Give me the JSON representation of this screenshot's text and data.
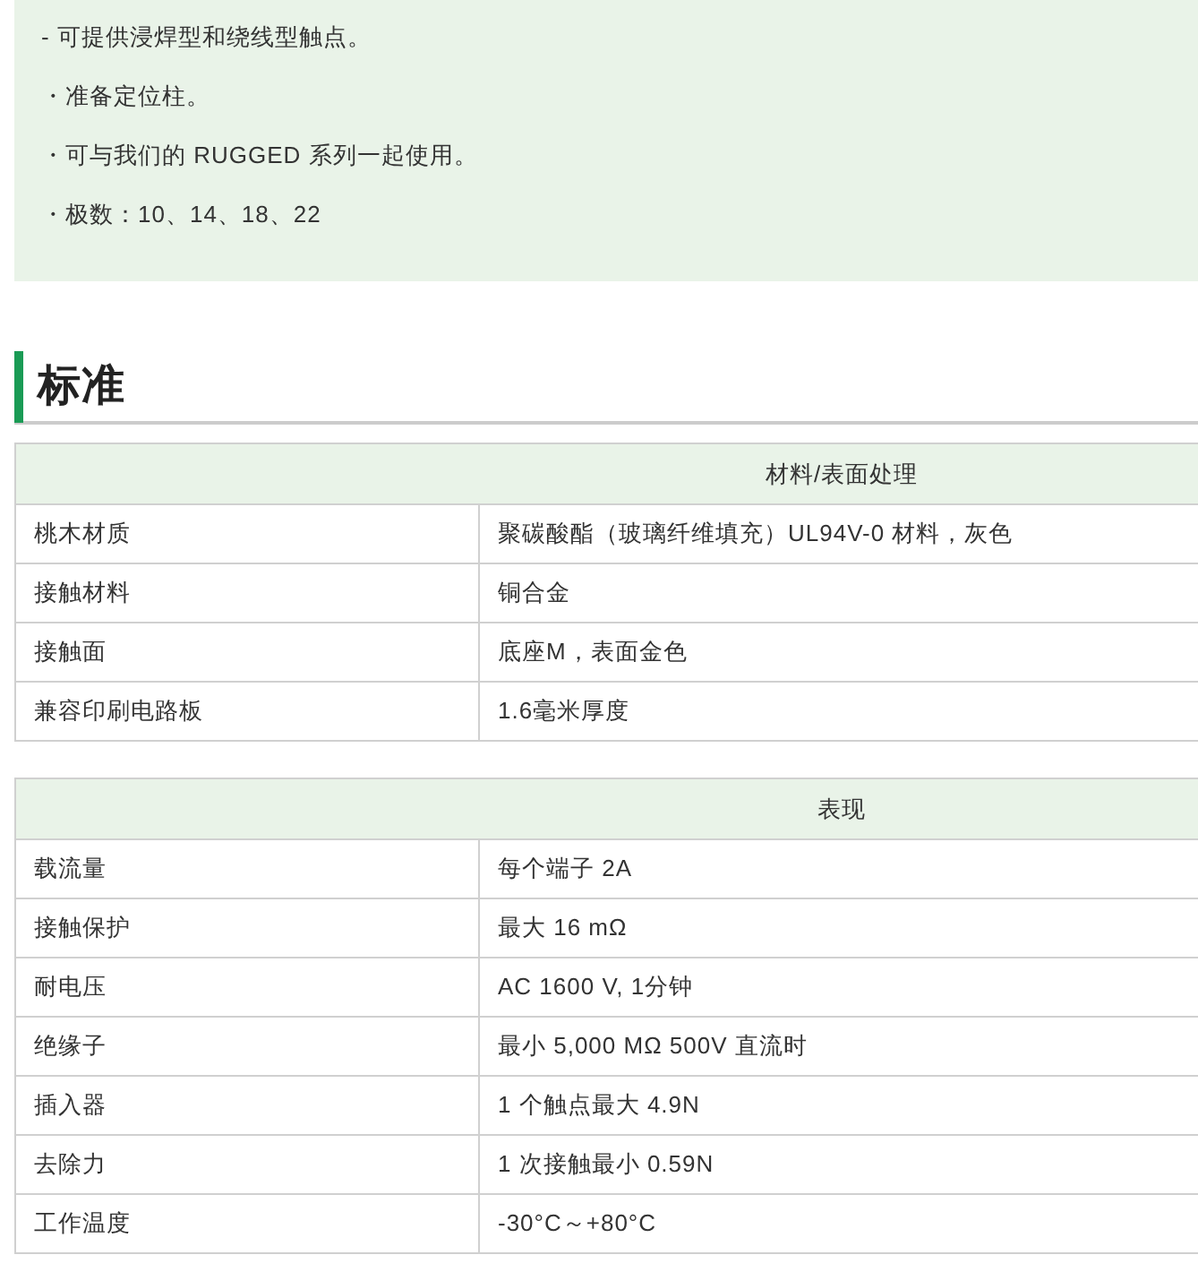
{
  "features": [
    "- 可提供浸焊型和绕线型触点。",
    "・准备定位柱。",
    "・可与我们的 RUGGED 系列一起使用。",
    "・极数：10、14、18、22"
  ],
  "heading": "标准",
  "tables": [
    {
      "header": "材料/表面处理",
      "rows": [
        [
          "桃木材质",
          "聚碳酸酯（玻璃纤维填充）UL94V-0 材料，灰色"
        ],
        [
          "接触材料",
          "铜合金"
        ],
        [
          "接触面",
          "底座M，表面金色"
        ],
        [
          "兼容印刷电路板",
          "1.6毫米厚度"
        ]
      ]
    },
    {
      "header": "表现",
      "rows": [
        [
          "载流量",
          "每个端子 2A"
        ],
        [
          "接触保护",
          "最大 16 mΩ"
        ],
        [
          "耐电压",
          "AC 1600 V, 1分钟"
        ],
        [
          "绝缘子",
          "最小 5,000 MΩ 500V 直流时"
        ],
        [
          "插入器",
          "1 个触点最大 4.9N"
        ],
        [
          "去除力",
          "1 次接触最小 0.59N"
        ],
        [
          "工作温度",
          "-30°C～+80°C"
        ]
      ]
    }
  ]
}
